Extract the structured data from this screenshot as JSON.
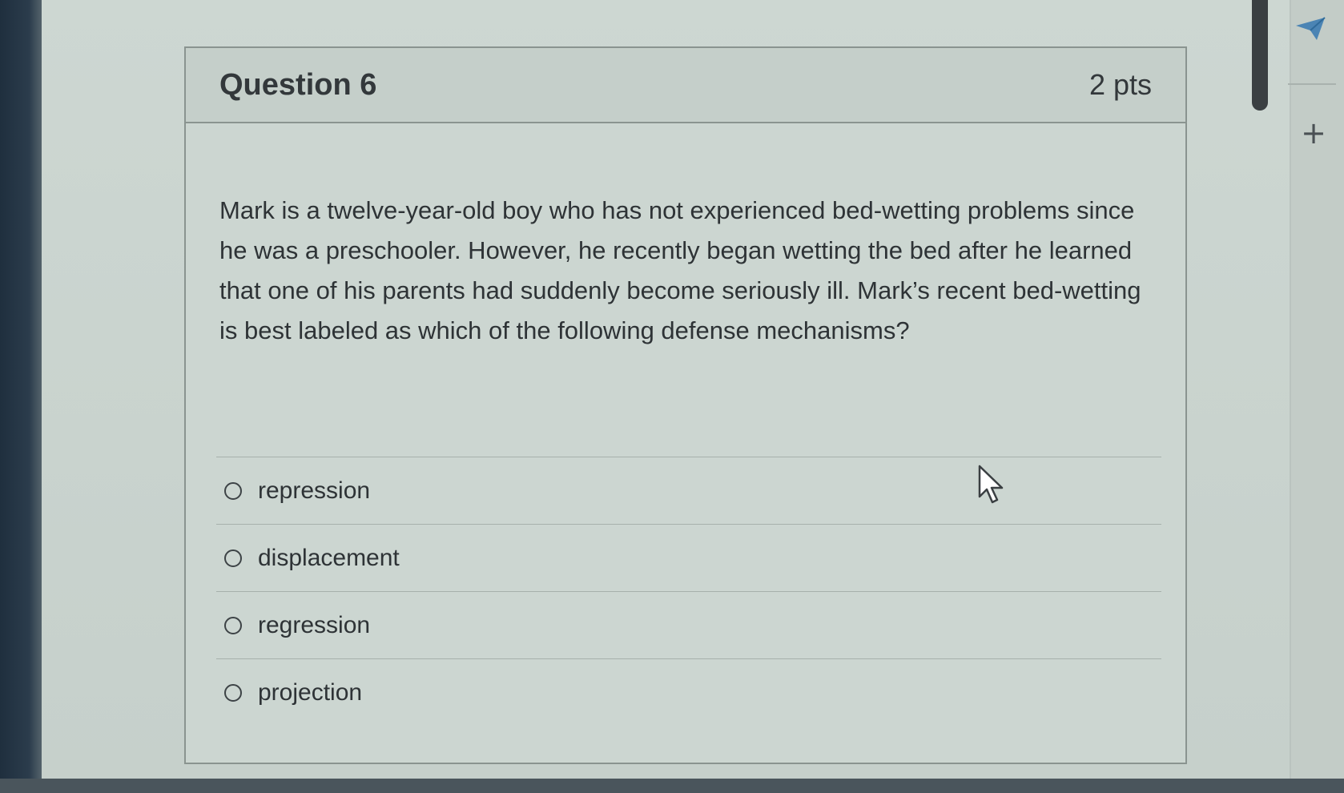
{
  "question": {
    "title": "Question 6",
    "points": "2 pts",
    "text": "Mark is a twelve-year-old boy who has not experienced bed-wetting problems since he was a preschooler. However, he recently began wetting the bed after he learned that one of his parents had suddenly become seriously ill. Mark’s recent bed-wetting is best labeled as which of the following defense mechanisms?"
  },
  "answers": [
    {
      "label": "repression"
    },
    {
      "label": "displacement"
    },
    {
      "label": "regression"
    },
    {
      "label": "projection"
    }
  ],
  "sidebar": {
    "icons": [
      "send-icon",
      "plus-icon"
    ],
    "plus_glyph": "+"
  },
  "colors": {
    "page_background": "#c9d2cc",
    "card_border": "#8a9490",
    "text": "#2f3437"
  }
}
